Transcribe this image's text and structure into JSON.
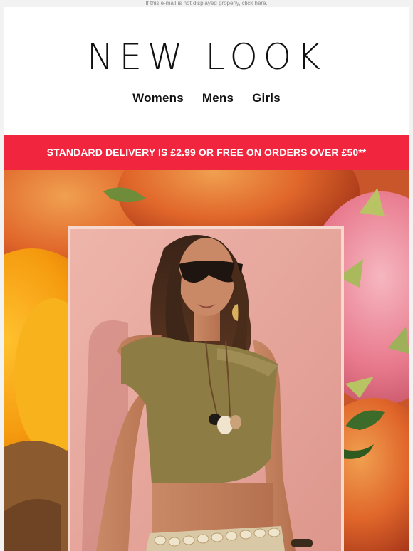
{
  "preheader": {
    "text": "If this e-mail is not displayed properly, click here."
  },
  "brand": {
    "logo_text": "NEW LOOK"
  },
  "nav": {
    "items": [
      {
        "label": "Womens"
      },
      {
        "label": "Mens"
      },
      {
        "label": "Girls"
      }
    ]
  },
  "banner": {
    "text": "STANDARD DELIVERY IS £2.99 OR FREE ON ORDERS OVER £50**",
    "color": "#f2253f"
  },
  "hero": {
    "image_name": "hero-image"
  },
  "colors": {
    "background": "#f2f2f2",
    "card": "#ffffff",
    "text": "#111111",
    "pink_wall": "#e8a9a0",
    "top_olive": "#8e7c45"
  }
}
